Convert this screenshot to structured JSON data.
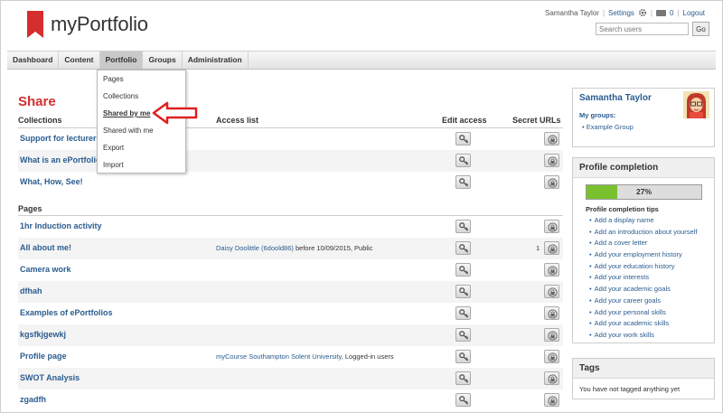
{
  "header": {
    "logo_text": "myPortfolio",
    "user_name": "Samantha Taylor",
    "settings_label": "Settings",
    "inbox_count": "0",
    "logout_label": "Logout",
    "search_placeholder": "Search users",
    "go_label": "Go"
  },
  "nav": {
    "items": [
      {
        "label": "Dashboard"
      },
      {
        "label": "Content"
      },
      {
        "label": "Portfolio"
      },
      {
        "label": "Groups"
      },
      {
        "label": "Administration"
      }
    ]
  },
  "dropdown": {
    "items": [
      {
        "label": "Pages"
      },
      {
        "label": "Collections"
      },
      {
        "label": "Shared by me"
      },
      {
        "label": "Shared with me"
      },
      {
        "label": "Export"
      },
      {
        "label": "Import"
      }
    ]
  },
  "main": {
    "title": "Share",
    "collections_heading": "Collections",
    "access_list_heading": "Access list",
    "edit_access_heading": "Edit access",
    "secret_urls_heading": "Secret URLs",
    "pages_heading": "Pages",
    "collections": [
      {
        "name": "Support for lecturers"
      },
      {
        "name": "What is an ePortfolio"
      },
      {
        "name": "What, How, See!"
      }
    ],
    "pages": [
      {
        "name": "1hr Induction activity"
      },
      {
        "name": "All about me!",
        "access_link": "Daisy Doolittle (6doold86)",
        "access_rest": " before 10/09/2015, Public",
        "secret_count": "1"
      },
      {
        "name": "Camera work"
      },
      {
        "name": "dfhah"
      },
      {
        "name": "Examples of ePortfolios"
      },
      {
        "name": "kgsfkjgewkj"
      },
      {
        "name": "Profile page",
        "access_link": "myCourse Southampton Solent University",
        "access_rest": ", Logged-in users"
      },
      {
        "name": "SWOT Analysis"
      },
      {
        "name": "zgadfh"
      }
    ]
  },
  "sidebar": {
    "user_panel": {
      "name": "Samantha Taylor",
      "my_groups_label": "My groups:",
      "groups": [
        "Example Group"
      ]
    },
    "profile_panel": {
      "title": "Profile completion",
      "percent_label": "27%",
      "percent_value": 27,
      "tips_title": "Profile completion tips",
      "tips": [
        "Add a display name",
        "Add an introduction about yourself",
        "Add a cover letter",
        "Add your employment history",
        "Add your education history",
        "Add your interests",
        "Add your academic goals",
        "Add your career goals",
        "Add your personal skills",
        "Add your academic skills",
        "Add your work skills"
      ]
    },
    "tags_panel": {
      "title": "Tags",
      "empty_text": "You have not tagged anything yet"
    }
  },
  "colors": {
    "accent_red": "#d62e2e",
    "link_blue": "#2a5c8f",
    "progress_green": "#79c12f"
  }
}
